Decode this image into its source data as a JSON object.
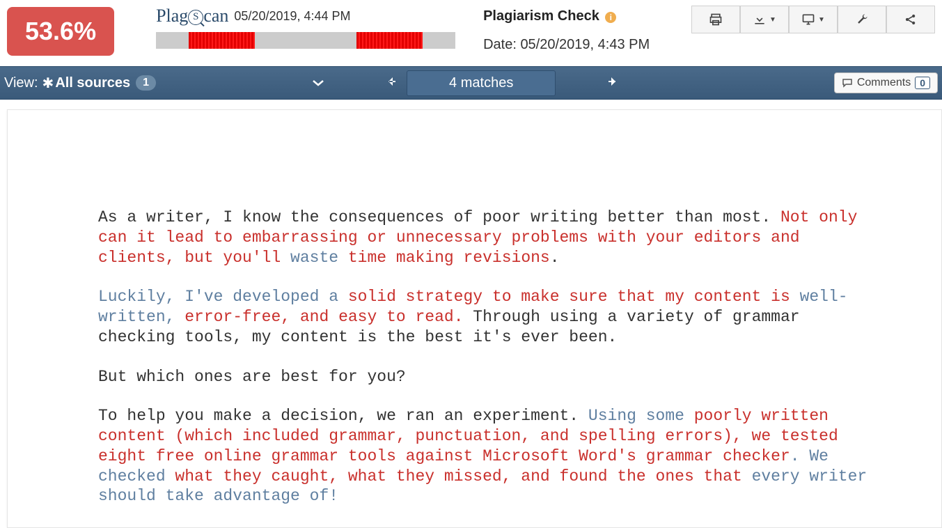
{
  "percentage": "53.6%",
  "logo_date": "05/20/2019, 4:44 PM",
  "check_title": "Plagiarism Check",
  "check_date": "Date: 05/20/2019, 4:43 PM",
  "bar_segments": [
    {
      "left_pct": 11,
      "width_pct": 22
    },
    {
      "left_pct": 67,
      "width_pct": 22
    }
  ],
  "navbar": {
    "view_label": "View:",
    "sources_label": "All sources",
    "sources_count": "1",
    "matches_label": "4 matches",
    "comments_label": "Comments",
    "comments_count": "0"
  },
  "document": {
    "paragraphs": [
      [
        {
          "t": "As a writer, I know the consequences of poor writing better than most. ",
          "c": ""
        },
        {
          "t": "Not only can it lead to embarrassing or unnecessary problems with your editors and clients, but you'll ",
          "c": "red"
        },
        {
          "t": "waste ",
          "c": "blue"
        },
        {
          "t": "time making revisions",
          "c": "red"
        },
        {
          "t": ".",
          "c": ""
        }
      ],
      [
        {
          "t": "Luckily, I've developed a ",
          "c": "blue"
        },
        {
          "t": "solid strategy to make sure that my content is ",
          "c": "red"
        },
        {
          "t": "well-written, ",
          "c": "blue"
        },
        {
          "t": "error-free, and easy to read.",
          "c": "red"
        },
        {
          "t": " Through using a variety of grammar checking tools, my content is the best it's ever been.",
          "c": ""
        }
      ],
      [
        {
          "t": "But which ones are best for you?",
          "c": ""
        }
      ],
      [
        {
          "t": "To help you make a decision, we ran an experiment. ",
          "c": ""
        },
        {
          "t": "Using some ",
          "c": "blue"
        },
        {
          "t": "poorly written content (which included grammar, punctuation, and spelling errors), we tested eight free online grammar tools against Microsoft Word's grammar checker",
          "c": "red"
        },
        {
          "t": ". ",
          "c": "blue"
        },
        {
          "t": "We checked ",
          "c": "blue"
        },
        {
          "t": "what they caught, what they missed, and found the ones that ",
          "c": "red"
        },
        {
          "t": "every writer should take advantage of!",
          "c": "blue"
        }
      ]
    ]
  }
}
